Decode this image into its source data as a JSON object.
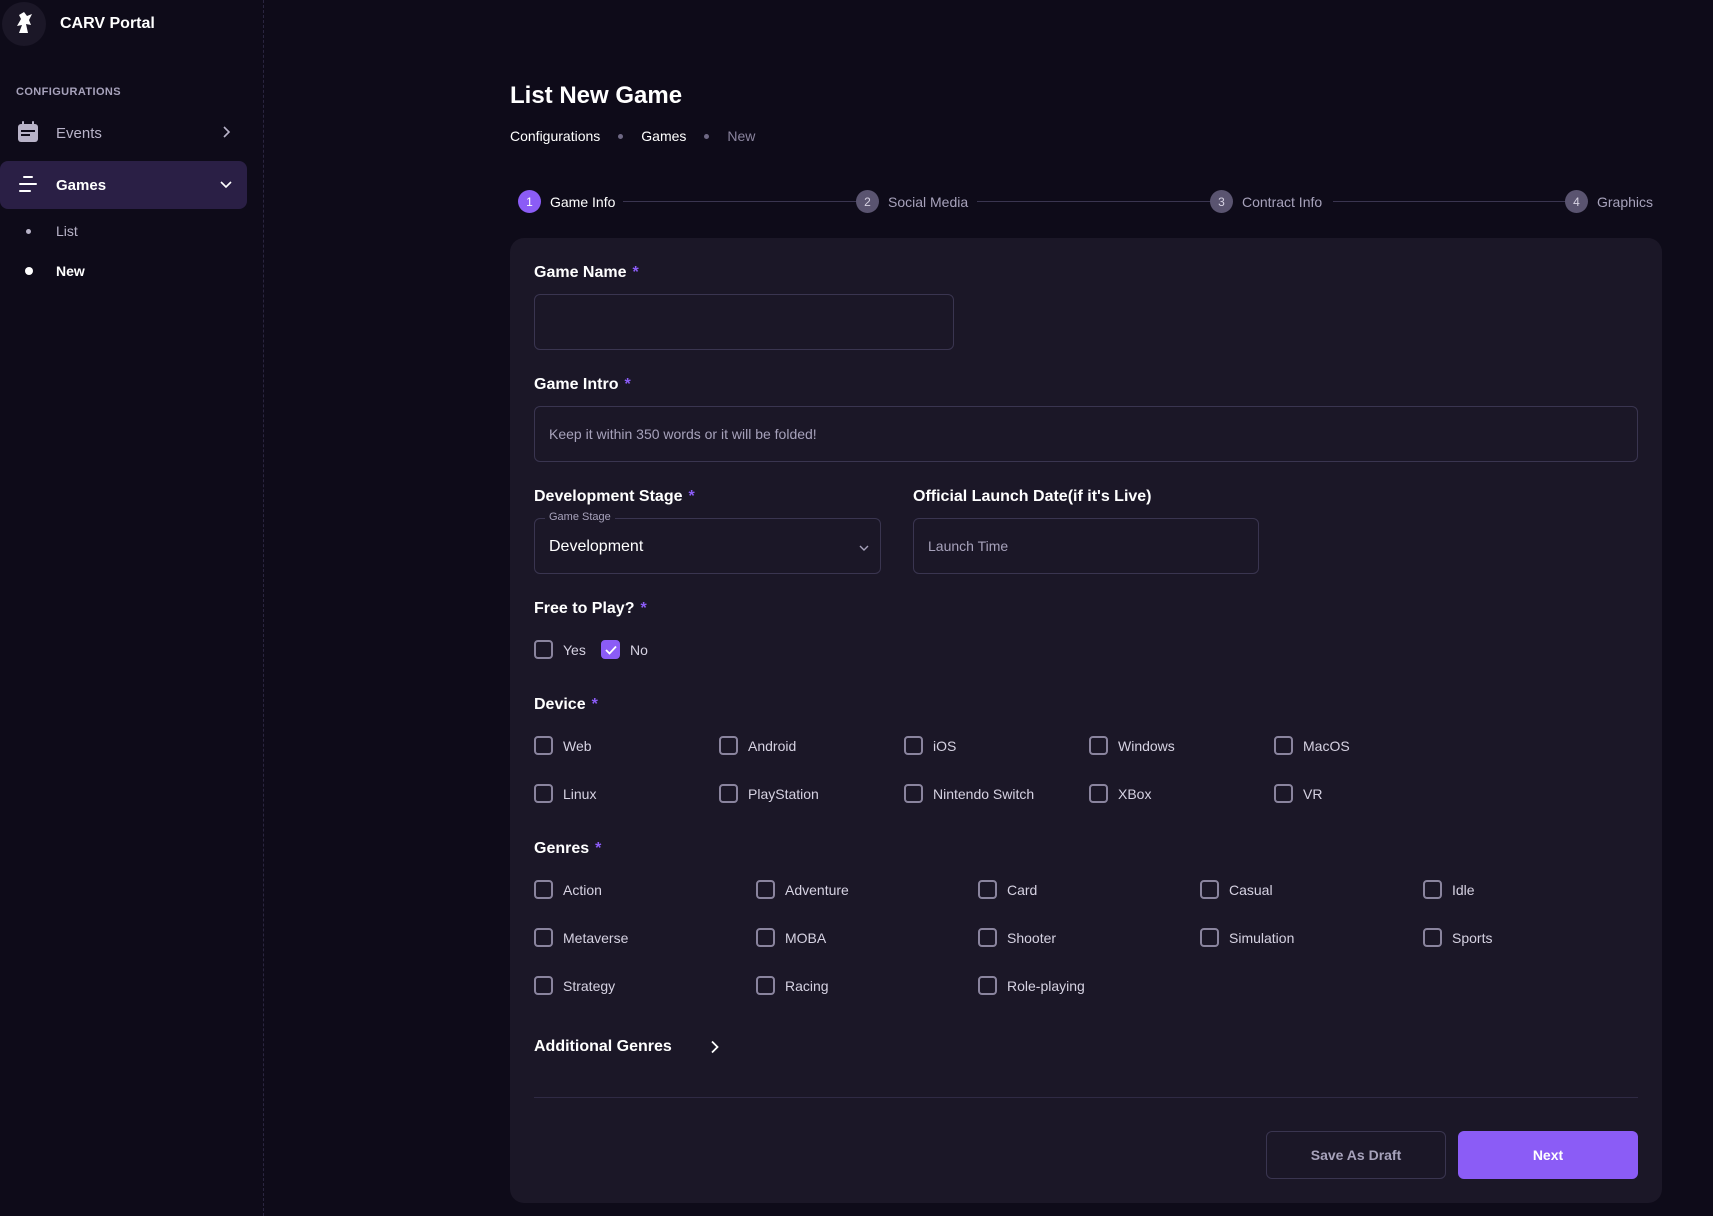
{
  "brand": {
    "name": "CARV Portal"
  },
  "sidebar": {
    "section_label": "CONFIGURATIONS",
    "items": [
      {
        "label": "Events",
        "icon": "calendar-icon",
        "expanded": false
      },
      {
        "label": "Games",
        "icon": "games-list-icon",
        "expanded": true,
        "active": true
      }
    ],
    "sub_items": [
      {
        "label": "List",
        "active": false
      },
      {
        "label": "New",
        "active": true
      }
    ]
  },
  "page": {
    "title": "List New Game",
    "breadcrumb": [
      "Configurations",
      "Games",
      "New"
    ]
  },
  "stepper": [
    {
      "num": "1",
      "label": "Game Info",
      "active": true
    },
    {
      "num": "2",
      "label": "Social Media",
      "active": false
    },
    {
      "num": "3",
      "label": "Contract Info",
      "active": false
    },
    {
      "num": "4",
      "label": "Graphics",
      "active": false
    }
  ],
  "form": {
    "game_name": {
      "label": "Game Name",
      "required": "*",
      "value": "",
      "placeholder": ""
    },
    "game_intro": {
      "label": "Game Intro",
      "required": "*",
      "value": "",
      "placeholder": "Keep it within 350 words or it will be folded!"
    },
    "dev_stage": {
      "label": "Development Stage",
      "required": "*",
      "legend": "Game Stage",
      "value": "Development"
    },
    "launch_date": {
      "label": "Official Launch Date(if it's Live)",
      "placeholder": "Launch Time"
    },
    "free_to_play": {
      "label": "Free to Play?",
      "required": "*",
      "options": [
        {
          "label": "Yes",
          "checked": false
        },
        {
          "label": "No",
          "checked": true
        }
      ]
    },
    "device": {
      "label": "Device",
      "required": "*",
      "options": [
        {
          "label": "Web",
          "checked": false
        },
        {
          "label": "Android",
          "checked": false
        },
        {
          "label": "iOS",
          "checked": false
        },
        {
          "label": "Windows",
          "checked": false
        },
        {
          "label": "MacOS",
          "checked": false
        },
        {
          "label": "Linux",
          "checked": false
        },
        {
          "label": "PlayStation",
          "checked": false
        },
        {
          "label": "Nintendo Switch",
          "checked": false
        },
        {
          "label": "XBox",
          "checked": false
        },
        {
          "label": "VR",
          "checked": false
        }
      ]
    },
    "genres": {
      "label": "Genres",
      "required": "*",
      "options": [
        {
          "label": "Action",
          "checked": false
        },
        {
          "label": "Adventure",
          "checked": false
        },
        {
          "label": "Card",
          "checked": false
        },
        {
          "label": "Casual",
          "checked": false
        },
        {
          "label": "Idle",
          "checked": false
        },
        {
          "label": "Metaverse",
          "checked": false
        },
        {
          "label": "MOBA",
          "checked": false
        },
        {
          "label": "Shooter",
          "checked": false
        },
        {
          "label": "Simulation",
          "checked": false
        },
        {
          "label": "Sports",
          "checked": false
        },
        {
          "label": "Strategy",
          "checked": false
        },
        {
          "label": "Racing",
          "checked": false
        },
        {
          "label": "Role-playing",
          "checked": false
        }
      ]
    },
    "additional_genres": {
      "label": "Additional Genres"
    }
  },
  "actions": {
    "save_draft_label": "Save As Draft",
    "next_label": "Next"
  },
  "colors": {
    "accent": "#8b5cf6",
    "background": "#0e0b19",
    "card": "#1b1727",
    "active_nav": "#2a1f45"
  }
}
